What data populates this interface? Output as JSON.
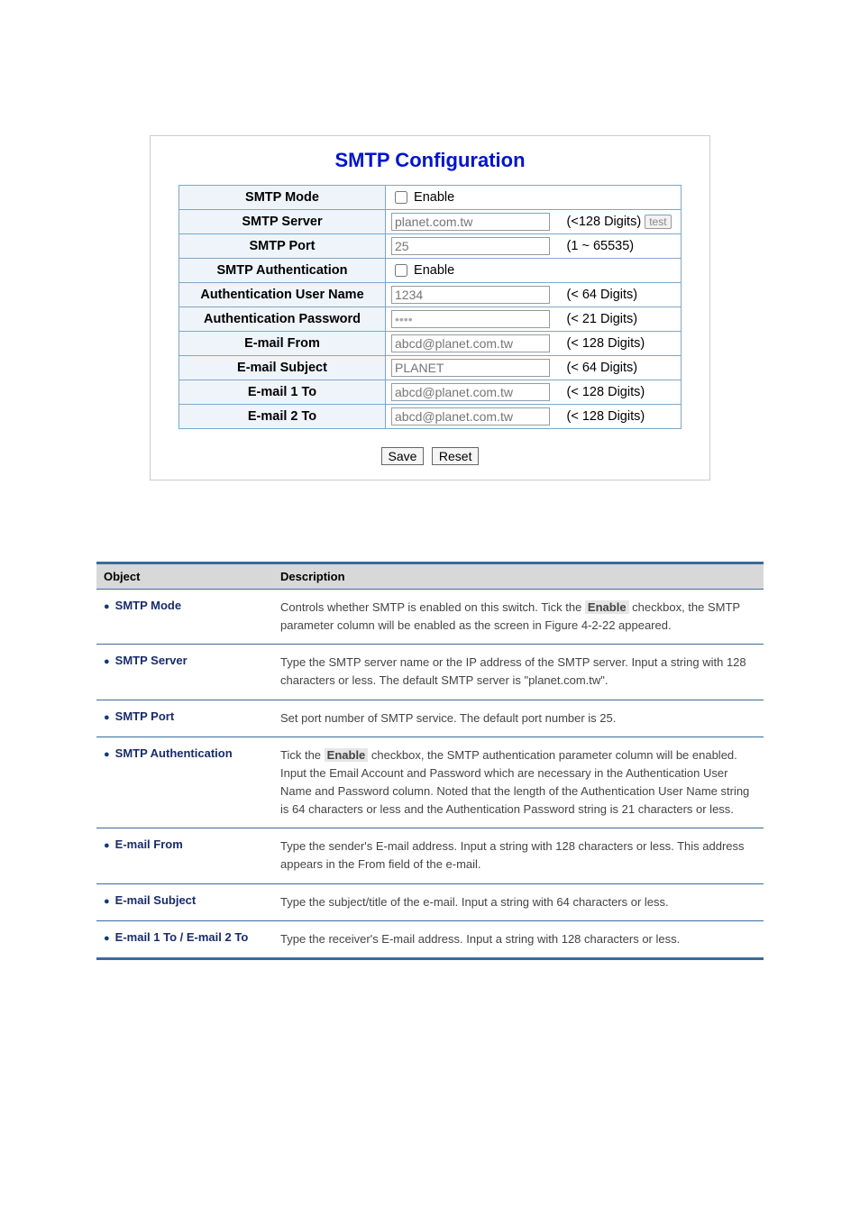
{
  "config": {
    "title": "SMTP Configuration",
    "rows": {
      "smtp_mode": {
        "label": "SMTP Mode",
        "checkbox_label": "Enable"
      },
      "smtp_server": {
        "label": "SMTP Server",
        "placeholder": "planet.com.tw",
        "hint": "(<128 Digits)",
        "btn": "test"
      },
      "smtp_port": {
        "label": "SMTP Port",
        "placeholder": "25",
        "hint": "(1 ~ 65535)"
      },
      "smtp_auth": {
        "label": "SMTP Authentication",
        "checkbox_label": "Enable"
      },
      "auth_user": {
        "label": "Authentication User Name",
        "placeholder": "1234",
        "hint": "(< 64 Digits)"
      },
      "auth_pass": {
        "label": "Authentication Password",
        "value": "••••",
        "hint": "(< 21 Digits)"
      },
      "email_from": {
        "label": "E-mail From",
        "placeholder": "abcd@planet.com.tw",
        "hint": "(< 128 Digits)"
      },
      "email_subject": {
        "label": "E-mail Subject",
        "placeholder": "PLANET",
        "hint": "(< 64 Digits)"
      },
      "email1": {
        "label": "E-mail 1 To",
        "placeholder": "abcd@planet.com.tw",
        "hint": "(< 128 Digits)"
      },
      "email2": {
        "label": "E-mail 2 To",
        "placeholder": "abcd@planet.com.tw",
        "hint": "(< 128 Digits)"
      }
    },
    "buttons": {
      "save": "Save",
      "reset": "Reset"
    }
  },
  "desc": {
    "head": {
      "object": "Object",
      "description": "Description"
    },
    "rows": [
      {
        "obj": "SMTP Mode",
        "desc_html": "Controls whether SMTP is enabled on this switch. Tick the <span class='kw'>Enable</span> checkbox, the SMTP parameter column will be enabled as the screen in Figure 4-2-22 appeared."
      },
      {
        "obj": "SMTP Server",
        "desc_html": "Type the SMTP server name or the IP address of the SMTP server. Input a string with 128 characters or less. The default SMTP server is \"planet.com.tw\"."
      },
      {
        "obj": "SMTP Port",
        "desc_html": "Set port number of SMTP service. The default port number is 25."
      },
      {
        "obj": "SMTP Authentication",
        "desc_html": "Tick the <span class='kw'>Enable</span> checkbox, the SMTP authentication parameter column will be enabled. Input the Email Account and Password which are necessary in the Authentication User Name and Password column. Noted that the length of the Authentication User Name string is 64 characters or less and the Authentication Password string is 21 characters or less."
      },
      {
        "obj": "E-mail From",
        "desc_html": "Type the sender's E-mail address. Input a string with 128 characters or less. This address appears in the From field of the e-mail."
      },
      {
        "obj": "E-mail Subject",
        "desc_html": "Type the subject/title of the e-mail. Input a string with 64 characters or less."
      },
      {
        "obj": "E-mail 1 To / E-mail 2 To",
        "desc_html": "Type the receiver's E-mail address. Input a string with 128 characters or less."
      }
    ]
  }
}
